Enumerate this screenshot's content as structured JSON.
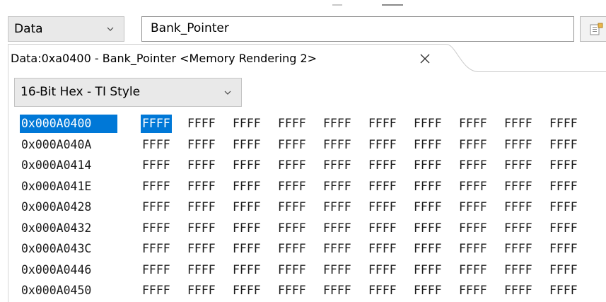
{
  "window": {
    "memory_space": "Data",
    "expression": "Bank_Pointer"
  },
  "tab": {
    "label": "Data:0xa0400 - Bank_Pointer <Memory Rendering 2>"
  },
  "rendering": {
    "format": "16-Bit Hex - TI Style"
  },
  "icons": {
    "space_dropdown": "chevron-down-icon",
    "format_dropdown": "chevron-down-icon",
    "tab_close": "close-icon",
    "expr_button": "add-rendering-icon"
  },
  "colors": {
    "selection": "#0078d7"
  },
  "memory": {
    "rows": [
      {
        "address": "0x000A0400",
        "cells": [
          "FFFF",
          "FFFF",
          "FFFF",
          "FFFF",
          "FFFF",
          "FFFF",
          "FFFF",
          "FFFF",
          "FFFF",
          "FFFF"
        ]
      },
      {
        "address": "0x000A040A",
        "cells": [
          "FFFF",
          "FFFF",
          "FFFF",
          "FFFF",
          "FFFF",
          "FFFF",
          "FFFF",
          "FFFF",
          "FFFF",
          "FFFF"
        ]
      },
      {
        "address": "0x000A0414",
        "cells": [
          "FFFF",
          "FFFF",
          "FFFF",
          "FFFF",
          "FFFF",
          "FFFF",
          "FFFF",
          "FFFF",
          "FFFF",
          "FFFF"
        ]
      },
      {
        "address": "0x000A041E",
        "cells": [
          "FFFF",
          "FFFF",
          "FFFF",
          "FFFF",
          "FFFF",
          "FFFF",
          "FFFF",
          "FFFF",
          "FFFF",
          "FFFF"
        ]
      },
      {
        "address": "0x000A0428",
        "cells": [
          "FFFF",
          "FFFF",
          "FFFF",
          "FFFF",
          "FFFF",
          "FFFF",
          "FFFF",
          "FFFF",
          "FFFF",
          "FFFF"
        ]
      },
      {
        "address": "0x000A0432",
        "cells": [
          "FFFF",
          "FFFF",
          "FFFF",
          "FFFF",
          "FFFF",
          "FFFF",
          "FFFF",
          "FFFF",
          "FFFF",
          "FFFF"
        ]
      },
      {
        "address": "0x000A043C",
        "cells": [
          "FFFF",
          "FFFF",
          "FFFF",
          "FFFF",
          "FFFF",
          "FFFF",
          "FFFF",
          "FFFF",
          "FFFF",
          "FFFF"
        ]
      },
      {
        "address": "0x000A0446",
        "cells": [
          "FFFF",
          "FFFF",
          "FFFF",
          "FFFF",
          "FFFF",
          "FFFF",
          "FFFF",
          "FFFF",
          "FFFF",
          "FFFF"
        ]
      },
      {
        "address": "0x000A0450",
        "cells": [
          "FFFF",
          "FFFF",
          "FFFF",
          "FFFF",
          "FFFF",
          "FFFF",
          "FFFF",
          "FFFF",
          "FFFF",
          "FFFF"
        ]
      }
    ]
  }
}
